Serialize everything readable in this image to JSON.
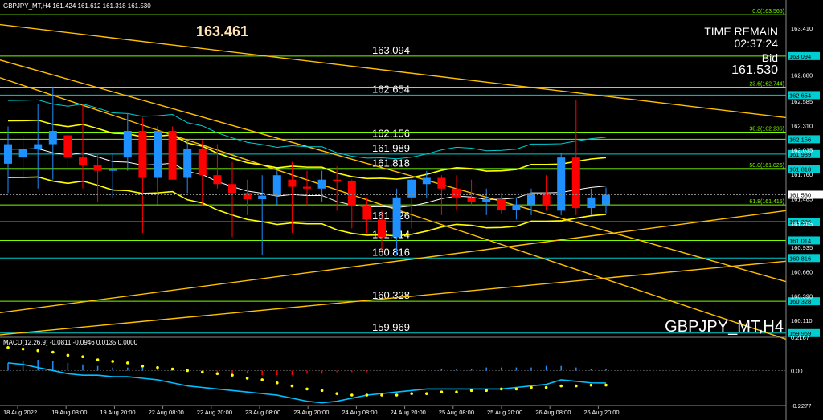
{
  "header": {
    "symbol_info": "GBPJPY_MT,H4  161.424 161.612 161.318 161.530",
    "big_price": "163.461",
    "time_remain_label": "TIME REMAIN",
    "time_remain_value": "02:37:24",
    "bid_label": "Bid",
    "bid_value": "161.530",
    "watermark": "GBPJPY_MT,H4"
  },
  "macd": {
    "label": "MACD(12,26,9) -0.0811 -0.0946 0.0135 0.0000",
    "axis_ticks": [
      "0.2167",
      "0.00",
      "-0.2277"
    ]
  },
  "colors": {
    "bull": "#1e90ff",
    "bear": "#ff0000",
    "level_line": "#7cfc00",
    "level_cyan": "#00ced1",
    "trend": "#ffc000",
    "bands": "#ffff00",
    "macd_line": "#00bfff",
    "macd_signal": "#ffff00"
  },
  "chart_data": {
    "type": "candlestick",
    "symbol": "GBPJPY_MT",
    "timeframe": "H4",
    "ylim": [
      159.94,
      163.6
    ],
    "price_ticks": [
      "163.410",
      "162.880",
      "162.585",
      "162.310",
      "162.035",
      "161.760",
      "161.485",
      "161.205",
      "160.935",
      "160.660",
      "160.390",
      "160.110"
    ],
    "x_labels": [
      "18 Aug 2022",
      "19 Aug 08:00",
      "19 Aug 20:00",
      "22 Aug 08:00",
      "22 Aug 20:00",
      "23 Aug 08:00",
      "23 Aug 20:00",
      "24 Aug 08:00",
      "24 Aug 20:00",
      "25 Aug 08:00",
      "25 Aug 20:00",
      "26 Aug 08:00",
      "26 Aug 20:00"
    ],
    "levels": [
      {
        "label": "163.094",
        "value": 163.094
      },
      {
        "label": "162.654",
        "value": 162.654
      },
      {
        "label": "162.156",
        "value": 162.156
      },
      {
        "label": "161.989",
        "value": 161.989
      },
      {
        "label": "161.818",
        "value": 161.818
      },
      {
        "label": "161.226",
        "value": 161.226
      },
      {
        "label": "161.014",
        "value": 161.014
      },
      {
        "label": "160.816",
        "value": 160.816
      },
      {
        "label": "160.328",
        "value": 160.328
      },
      {
        "label": "159.969",
        "value": 159.969
      }
    ],
    "fib_levels": [
      {
        "label": "0.0(163.565)",
        "value": 163.565
      },
      {
        "label": "23.6(162.744)",
        "value": 162.744
      },
      {
        "label": "38.2(162.236)",
        "value": 162.236
      },
      {
        "label": "50.0(161.826)",
        "value": 161.826
      },
      {
        "label": "61.8(161.415)",
        "value": 161.415
      }
    ],
    "current_price": {
      "label": "161.530",
      "value": 161.53
    },
    "candles": [
      {
        "o": 161.88,
        "h": 162.3,
        "l": 161.55,
        "c": 162.1
      },
      {
        "o": 161.95,
        "h": 162.2,
        "l": 161.7,
        "c": 162.05
      },
      {
        "o": 162.05,
        "h": 162.55,
        "l": 161.6,
        "c": 162.1
      },
      {
        "o": 162.1,
        "h": 162.75,
        "l": 161.7,
        "c": 162.25
      },
      {
        "o": 162.2,
        "h": 162.3,
        "l": 161.8,
        "c": 161.95
      },
      {
        "o": 161.95,
        "h": 162.55,
        "l": 161.6,
        "c": 161.86
      },
      {
        "o": 161.86,
        "h": 162.0,
        "l": 161.45,
        "c": 161.8
      },
      {
        "o": 161.8,
        "h": 162.0,
        "l": 161.5,
        "c": 161.82
      },
      {
        "o": 161.95,
        "h": 162.45,
        "l": 161.8,
        "c": 162.25
      },
      {
        "o": 162.25,
        "h": 162.4,
        "l": 161.1,
        "c": 161.72
      },
      {
        "o": 161.72,
        "h": 162.3,
        "l": 161.4,
        "c": 162.25
      },
      {
        "o": 162.25,
        "h": 162.3,
        "l": 161.7,
        "c": 161.7
      },
      {
        "o": 161.72,
        "h": 162.15,
        "l": 161.55,
        "c": 162.05
      },
      {
        "o": 162.05,
        "h": 162.15,
        "l": 161.4,
        "c": 161.75
      },
      {
        "o": 161.75,
        "h": 162.1,
        "l": 161.6,
        "c": 161.65
      },
      {
        "o": 161.65,
        "h": 161.9,
        "l": 161.05,
        "c": 161.55
      },
      {
        "o": 161.55,
        "h": 161.7,
        "l": 161.3,
        "c": 161.48
      },
      {
        "o": 161.48,
        "h": 161.75,
        "l": 160.85,
        "c": 161.52
      },
      {
        "o": 161.52,
        "h": 161.8,
        "l": 161.4,
        "c": 161.75
      },
      {
        "o": 161.7,
        "h": 161.9,
        "l": 161.1,
        "c": 161.62
      },
      {
        "o": 161.62,
        "h": 161.8,
        "l": 161.4,
        "c": 161.6
      },
      {
        "o": 161.6,
        "h": 161.8,
        "l": 161.45,
        "c": 161.7
      },
      {
        "o": 161.7,
        "h": 161.85,
        "l": 161.35,
        "c": 161.68
      },
      {
        "o": 161.68,
        "h": 161.7,
        "l": 161.15,
        "c": 161.4
      },
      {
        "o": 161.4,
        "h": 161.5,
        "l": 161.1,
        "c": 161.25
      },
      {
        "o": 161.25,
        "h": 161.35,
        "l": 160.9,
        "c": 161.05
      },
      {
        "o": 161.05,
        "h": 161.6,
        "l": 160.85,
        "c": 161.5
      },
      {
        "o": 161.5,
        "h": 161.75,
        "l": 161.15,
        "c": 161.7
      },
      {
        "o": 161.65,
        "h": 161.8,
        "l": 161.5,
        "c": 161.72
      },
      {
        "o": 161.72,
        "h": 161.75,
        "l": 161.3,
        "c": 161.6
      },
      {
        "o": 161.6,
        "h": 161.75,
        "l": 161.35,
        "c": 161.5
      },
      {
        "o": 161.5,
        "h": 161.7,
        "l": 161.4,
        "c": 161.45
      },
      {
        "o": 161.45,
        "h": 161.6,
        "l": 161.3,
        "c": 161.48
      },
      {
        "o": 161.48,
        "h": 161.55,
        "l": 161.32,
        "c": 161.36
      },
      {
        "o": 161.36,
        "h": 161.5,
        "l": 161.25,
        "c": 161.42
      },
      {
        "o": 161.42,
        "h": 161.6,
        "l": 161.3,
        "c": 161.55
      },
      {
        "o": 161.55,
        "h": 161.75,
        "l": 161.35,
        "c": 161.4
      },
      {
        "o": 161.35,
        "h": 162.0,
        "l": 161.3,
        "c": 161.95
      },
      {
        "o": 161.95,
        "h": 162.6,
        "l": 161.3,
        "c": 161.38
      },
      {
        "o": 161.38,
        "h": 161.6,
        "l": 161.3,
        "c": 161.5
      },
      {
        "o": 161.42,
        "h": 161.61,
        "l": 161.32,
        "c": 161.53
      }
    ],
    "macd_hist": [
      0.05,
      0.06,
      0.07,
      0.06,
      0.05,
      0.04,
      0.03,
      0.02,
      0.02,
      0.03,
      0.02,
      0.01,
      0.0,
      -0.01,
      -0.02,
      -0.02,
      -0.02,
      -0.03,
      -0.03,
      -0.03,
      -0.02,
      -0.02,
      -0.01,
      -0.01,
      -0.01,
      0.0,
      0.0,
      0.0,
      0.0,
      0.01,
      0.01,
      0.01,
      0.02,
      0.02,
      0.02,
      0.02,
      0.03,
      0.03,
      0.02,
      0.01,
      0.01
    ],
    "macd_line": [
      0.05,
      0.04,
      0.02,
      0.0,
      -0.02,
      -0.03,
      -0.03,
      -0.04,
      -0.04,
      -0.05,
      -0.06,
      -0.08,
      -0.1,
      -0.11,
      -0.12,
      -0.13,
      -0.14,
      -0.15,
      -0.16,
      -0.18,
      -0.2,
      -0.21,
      -0.2,
      -0.18,
      -0.16,
      -0.15,
      -0.14,
      -0.13,
      -0.12,
      -0.12,
      -0.12,
      -0.12,
      -0.12,
      -0.12,
      -0.11,
      -0.1,
      -0.09,
      -0.06,
      -0.07,
      -0.08,
      -0.081
    ],
    "macd_signal": [
      0.15,
      0.14,
      0.13,
      0.12,
      0.1,
      0.09,
      0.07,
      0.06,
      0.05,
      0.03,
      0.02,
      0.01,
      0.0,
      -0.01,
      -0.02,
      -0.03,
      -0.05,
      -0.06,
      -0.08,
      -0.1,
      -0.12,
      -0.13,
      -0.15,
      -0.16,
      -0.16,
      -0.16,
      -0.16,
      -0.15,
      -0.15,
      -0.14,
      -0.14,
      -0.13,
      -0.13,
      -0.12,
      -0.12,
      -0.11,
      -0.11,
      -0.1,
      -0.1,
      -0.095,
      -0.0946
    ]
  }
}
